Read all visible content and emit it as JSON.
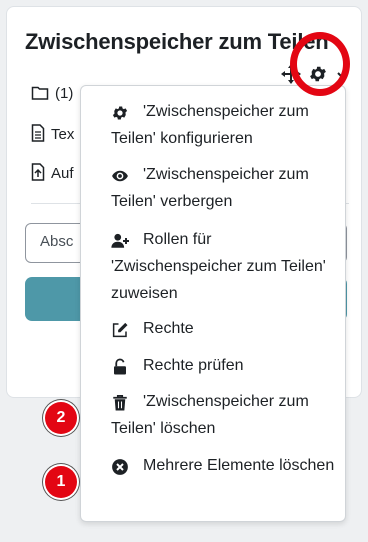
{
  "card": {
    "title": "Zwischenspeicher zum Teilen",
    "rows": [
      {
        "icon": "folder-icon",
        "text": "(1)"
      },
      {
        "icon": "file-text-icon",
        "text": "Tex"
      },
      {
        "icon": "file-upload-icon",
        "text": "Auf"
      }
    ],
    "select_text": "Absc"
  },
  "menu": {
    "items": [
      {
        "icon": "gear-icon",
        "label": "'Zwischenspeicher zum Teilen' konfigurieren"
      },
      {
        "icon": "eye-icon",
        "label": "'Zwischenspeicher zum Teilen' verbergen"
      },
      {
        "icon": "user-plus-icon",
        "label": "Rollen für 'Zwischenspeicher zum Teilen' zuweisen"
      },
      {
        "icon": "pencil-square-icon",
        "label": "Rechte"
      },
      {
        "icon": "unlock-icon",
        "label": "Rechte prüfen"
      },
      {
        "icon": "trash-icon",
        "label": "'Zwischenspeicher zum Teilen' löschen"
      },
      {
        "icon": "x-circle-icon",
        "label": "Mehrere Elemente löschen"
      }
    ]
  },
  "annotations": {
    "badge_1": "1",
    "badge_2": "2",
    "highlight_color": "#e30613"
  },
  "colors": {
    "primary_button": "#4e98a8"
  }
}
